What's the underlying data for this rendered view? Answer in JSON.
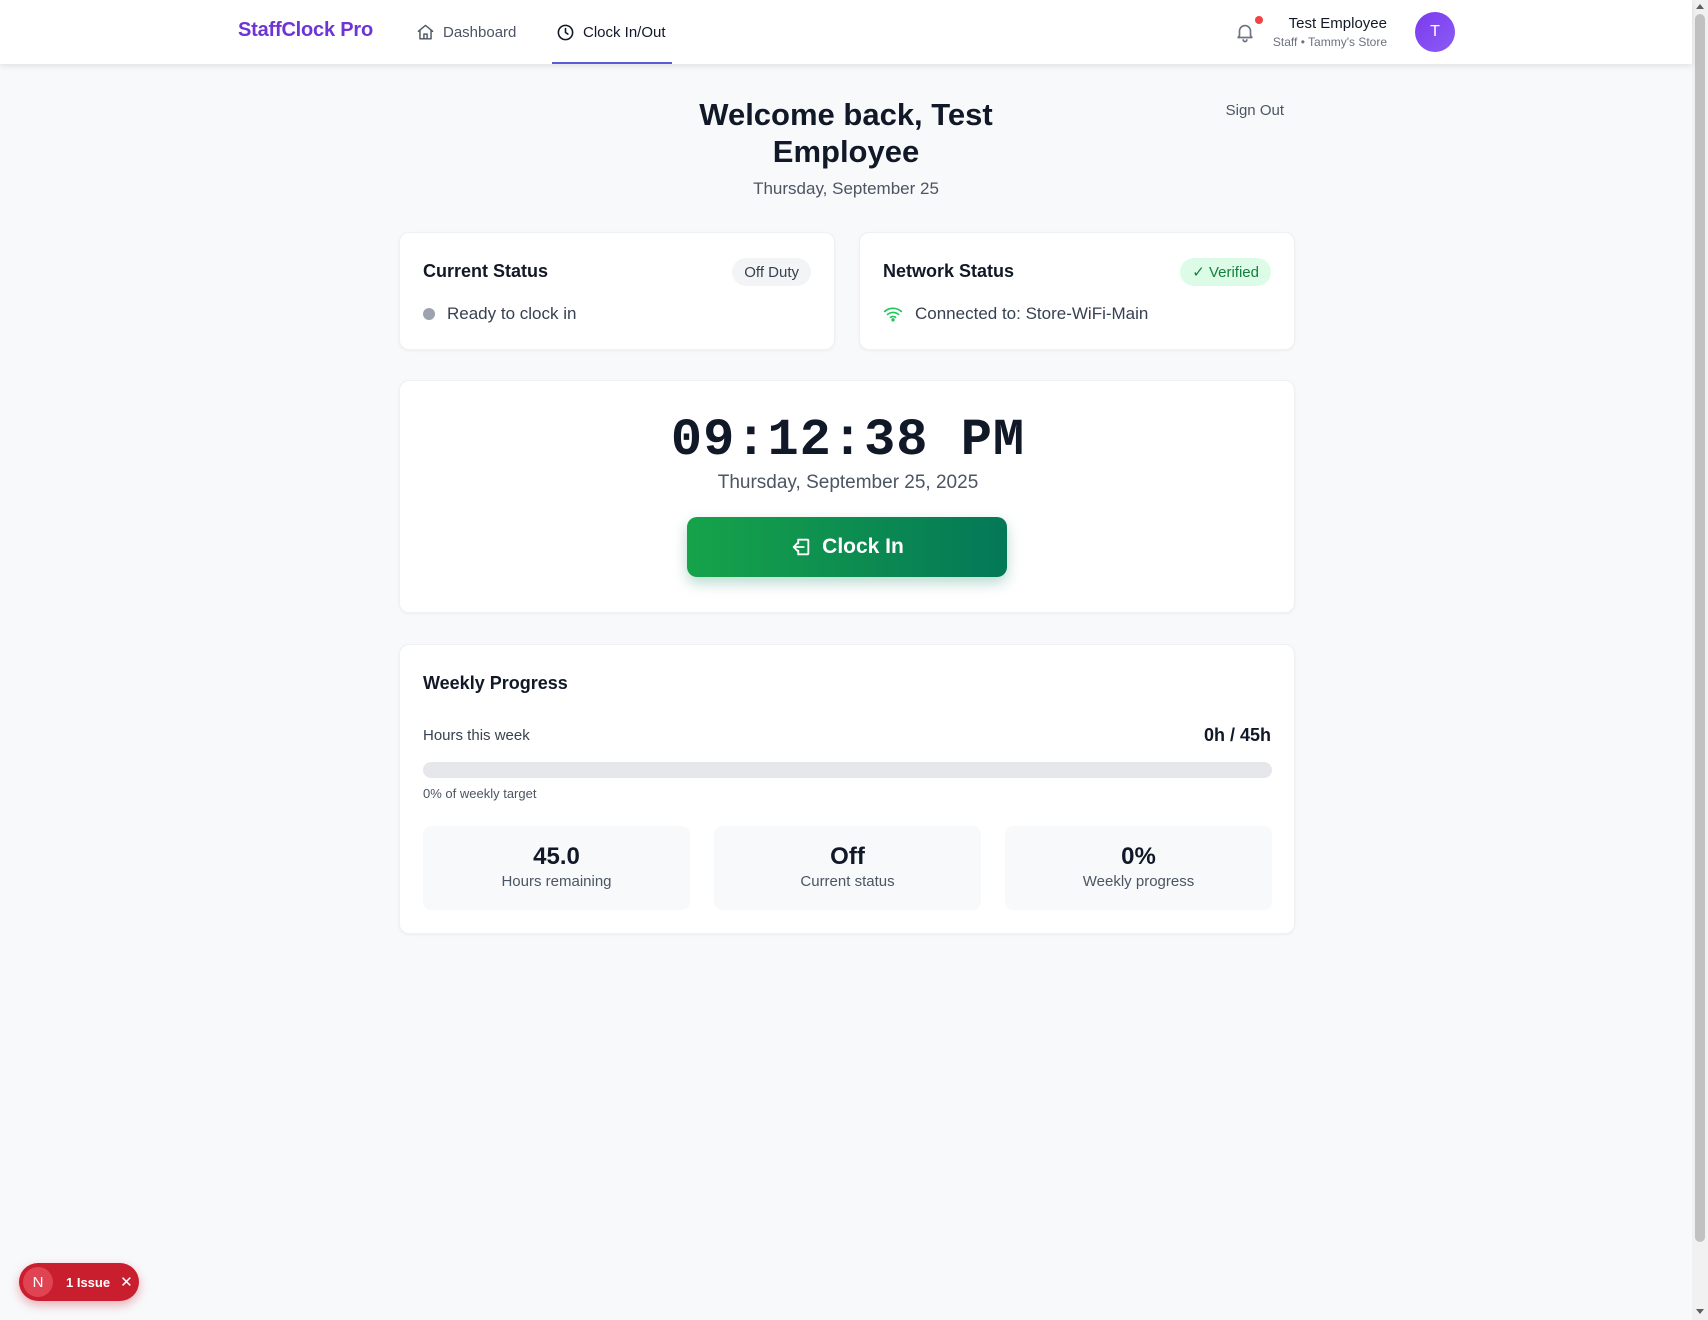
{
  "nav": {
    "brand": "StaffClock Pro",
    "links": [
      {
        "label": "Dashboard",
        "icon": "home-icon"
      },
      {
        "label": "Clock In/Out",
        "icon": "clock-icon",
        "active": true
      }
    ],
    "user": {
      "name": "Test Employee",
      "role": "Staff • Tammy's Store",
      "initial": "T"
    },
    "notification_dot_color": "#ef4444"
  },
  "header": {
    "welcome": "Welcome back, Test Employee",
    "date": "Thursday, September 25",
    "sign_out": "Sign Out"
  },
  "current_status": {
    "title": "Current Status",
    "badge": "Off Duty",
    "text": "Ready to clock in"
  },
  "network_status": {
    "title": "Network Status",
    "badge": "✓ Verified",
    "text": "Connected to: Store-WiFi-Main"
  },
  "clock": {
    "time": "09:12:38 PM",
    "date": "Thursday, September 25, 2025",
    "button_label": "Clock In"
  },
  "weekly": {
    "title": "Weekly Progress",
    "hours_label": "Hours this week",
    "hours_value": "0h / 45h",
    "progress_fraction": 0,
    "target_label": "0% of weekly target",
    "stats": [
      {
        "value": "45.0",
        "label": "Hours remaining"
      },
      {
        "value": "Off",
        "label": "Current status"
      },
      {
        "value": "0%",
        "label": "Weekly progress"
      }
    ]
  },
  "issue_badge": {
    "initial": "N",
    "text": "1 Issue",
    "close": "✕"
  },
  "colors": {
    "brand": "#6d35d6",
    "clock_in_button": "#16a34a",
    "verified": "#15803d",
    "issue": "#c81e2e"
  }
}
